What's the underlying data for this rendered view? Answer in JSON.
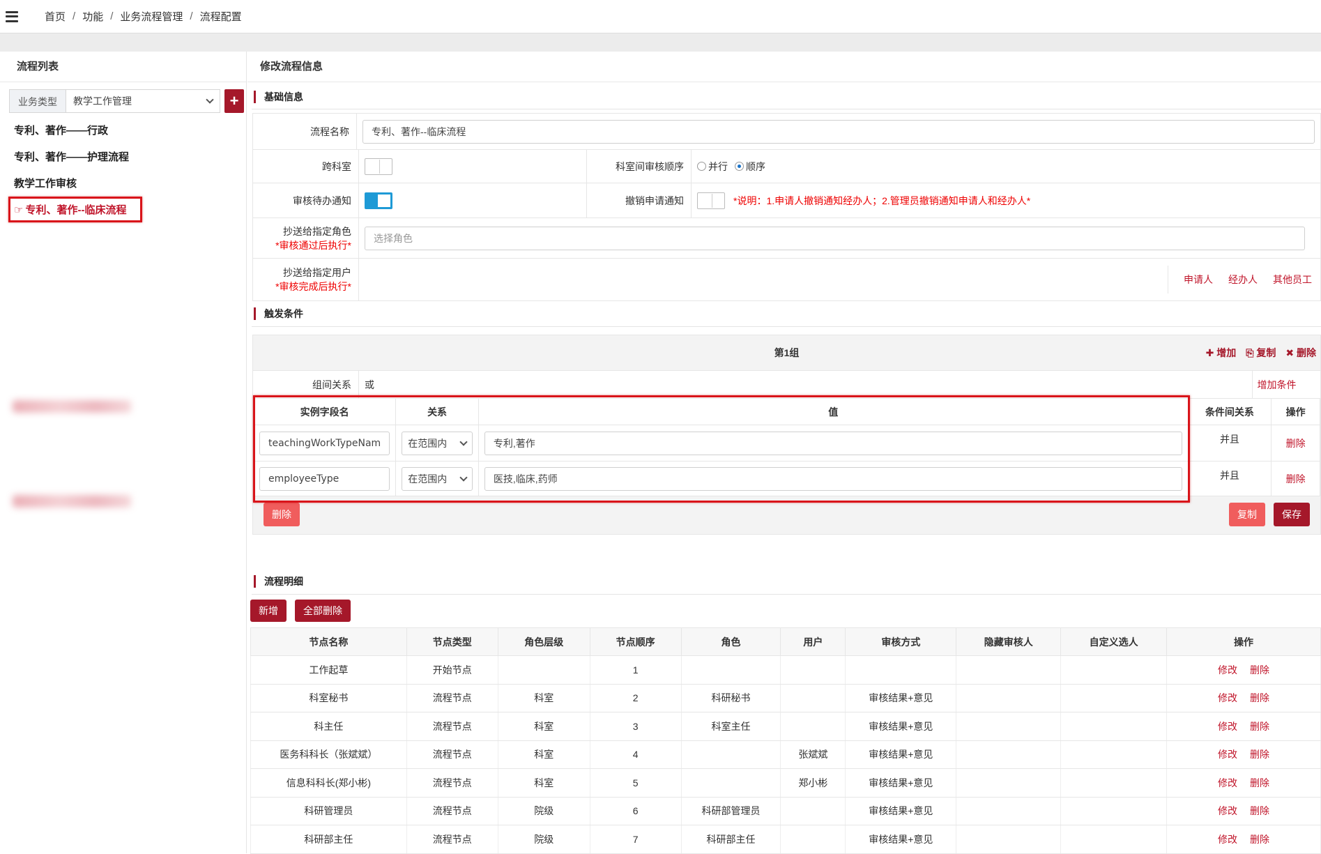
{
  "breadcrumb": [
    "首页",
    "功能",
    "业务流程管理",
    "流程配置"
  ],
  "left": {
    "title": "流程列表",
    "type_label": "业务类型",
    "type_value": "教学工作管理",
    "add_label": "+",
    "items": [
      "专利、著作——行政",
      "专利、著作——护理流程",
      "教学工作审核",
      "专利、著作--临床流程"
    ]
  },
  "right": {
    "title": "修改流程信息",
    "basic_section": "基础信息",
    "flow_name_label": "流程名称",
    "flow_name_value": "专利、著作--临床流程",
    "cross_dept_label": "跨科室",
    "dept_order_label": "科室间审核顺序",
    "order_parallel": "并行",
    "order_sequential": "顺序",
    "todo_notify_label": "审核待办通知",
    "cancel_notify_label": "撤销申请通知",
    "cancel_note": "*说明：1.申请人撤销通知经办人；2.管理员撤销通知申请人和经办人*",
    "cc_role_label": "抄送给指定角色",
    "cc_role_note": "*审核通过后执行*",
    "cc_role_placeholder": "选择角色",
    "cc_user_label": "抄送给指定用户",
    "cc_user_note": "*审核完成后执行*",
    "cc_user_links": [
      "申请人",
      "经办人",
      "其他员工"
    ],
    "trigger_section": "触发条件",
    "group_title": "第1组",
    "group_actions": [
      "✚ 增加",
      "⎘ 复制",
      "✖ 删除"
    ],
    "group_relation_label": "组间关系",
    "group_relation_value": "或",
    "add_condition": "增加条件",
    "cond_headers": [
      "实例字段名",
      "关系",
      "值",
      "条件间关系",
      "操作"
    ],
    "conditions": [
      {
        "field": "teachingWorkTypeNam",
        "relation": "在范围内",
        "value": "专利,著作",
        "join": "并且",
        "op": "删除"
      },
      {
        "field": "employeeType",
        "relation": "在范围内",
        "value": "医技,临床,药师",
        "join": "并且",
        "op": "删除"
      }
    ],
    "delete_btn": "删除",
    "copy_btn": "复制",
    "save_btn": "保存",
    "detail_section": "流程明细",
    "new_btn": "新增",
    "delete_all_btn": "全部删除",
    "detail_headers": [
      "节点名称",
      "节点类型",
      "角色层级",
      "节点顺序",
      "角色",
      "用户",
      "审核方式",
      "隐藏审核人",
      "自定义选人",
      "操作"
    ],
    "detail_rows": [
      {
        "name": "工作起草",
        "type": "开始节点",
        "level": "",
        "order": "1",
        "role": "",
        "user": "",
        "method": ""
      },
      {
        "name": "科室秘书",
        "type": "流程节点",
        "level": "科室",
        "order": "2",
        "role": "科研秘书",
        "user": "",
        "method": "审核结果+意见"
      },
      {
        "name": "科主任",
        "type": "流程节点",
        "level": "科室",
        "order": "3",
        "role": "科室主任",
        "user": "",
        "method": "审核结果+意见"
      },
      {
        "name": "医务科科长（张斌斌）",
        "type": "流程节点",
        "level": "科室",
        "order": "4",
        "role": "",
        "user": "张斌斌",
        "method": "审核结果+意见"
      },
      {
        "name": "信息科科长(郑小彬)",
        "type": "流程节点",
        "level": "科室",
        "order": "5",
        "role": "",
        "user": "郑小彬",
        "method": "审核结果+意见"
      },
      {
        "name": "科研管理员",
        "type": "流程节点",
        "level": "院级",
        "order": "6",
        "role": "科研部管理员",
        "user": "",
        "method": "审核结果+意见"
      },
      {
        "name": "科研部主任",
        "type": "流程节点",
        "level": "院级",
        "order": "7",
        "role": "科研部主任",
        "user": "",
        "method": "审核结果+意见"
      }
    ],
    "edit_label": "修改",
    "del_label": "删除"
  },
  "colors": {
    "brand": "#a5182a",
    "accent_red": "#e00000",
    "toggle_on": "#1e9ad6"
  }
}
